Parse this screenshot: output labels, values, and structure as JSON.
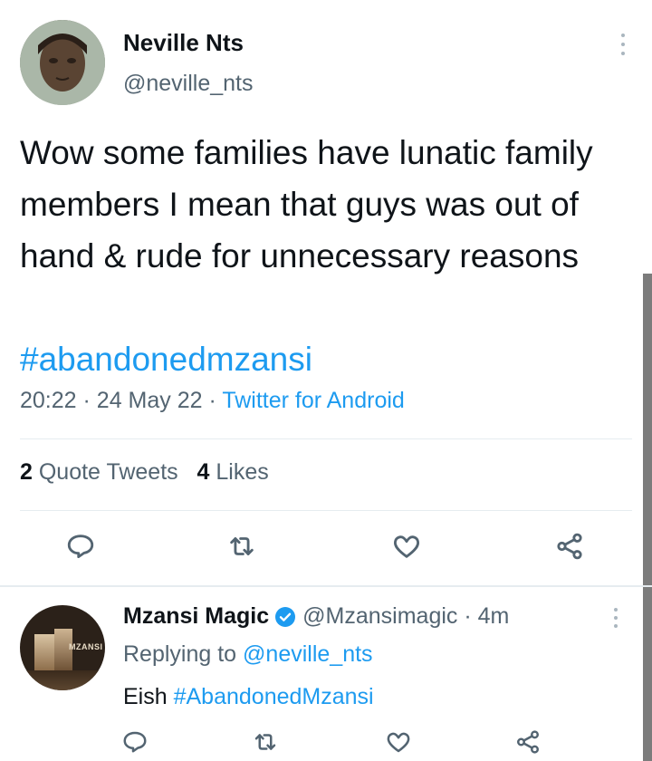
{
  "tweet": {
    "author_name": "Neville Nts",
    "author_handle": "@neville_nts",
    "text": "Wow some families have lunatic family members I mean that guys was out of hand & rude for unnecessary reasons",
    "hashtag": "#abandonedmzansi",
    "time": "20:22",
    "date": "24 May 22",
    "separator": "·",
    "source": "Twitter for Android",
    "stats": {
      "quote_count": "2",
      "quote_label": "Quote Tweets",
      "like_count": "4",
      "like_label": "Likes"
    },
    "icons": [
      "reply-icon",
      "retweet-icon",
      "like-icon",
      "share-icon"
    ]
  },
  "reply": {
    "author_name": "Mzansi Magic",
    "author_handle": "@Mzansimagic",
    "separator": "·",
    "time_ago": "4m",
    "replying_prefix": "Replying to",
    "replying_to": "@neville_nts",
    "text": "Eish",
    "hashtag": "#AbandonedMzansi",
    "avatar_logo_text": "MZANSI",
    "icons": [
      "verified-icon",
      "reply-icon",
      "retweet-icon",
      "like-icon",
      "share-icon"
    ]
  },
  "colors": {
    "link": "#1d9bf0",
    "secondary_text": "#536471",
    "primary_text": "#0f1419",
    "divider": "#e6ecf0",
    "verified": "#1d9bf0"
  }
}
